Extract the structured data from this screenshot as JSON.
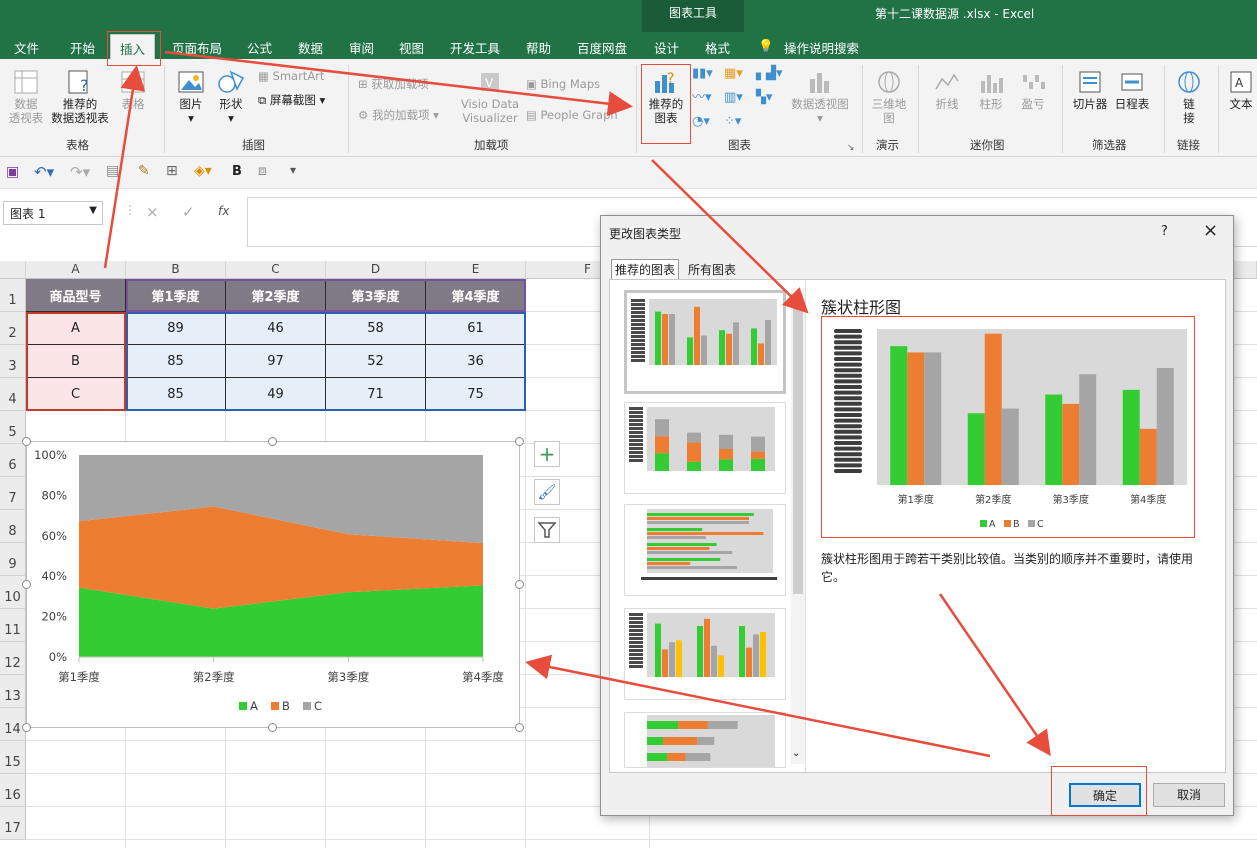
{
  "titlebar": {
    "context_tool": "图表工具",
    "document_title": "第十二课数据源 .xlsx  -  Excel"
  },
  "tabs": [
    "文件",
    "开始",
    "插入",
    "页面布局",
    "公式",
    "数据",
    "审阅",
    "视图",
    "开发工具",
    "帮助",
    "百度网盘",
    "设计",
    "格式"
  ],
  "tellme": "操作说明搜索",
  "ribbon": {
    "pivot_l1": "数据",
    "pivot_l2": "透视表",
    "rec_pivot_l1": "推荐的",
    "rec_pivot_l2": "数据透视表",
    "table": "表格",
    "picture": "图片",
    "shapes": "形状",
    "smartart": "SmartArt",
    "screenshot": "屏幕截图",
    "get_addins": "获取加载项",
    "my_addins": "我的加载项",
    "visio_l1": "Visio Data",
    "visio_l2": "Visualizer",
    "bing_maps": "Bing Maps",
    "people_graph": "People Graph",
    "rec_chart_l1": "推荐的",
    "rec_chart_l2": "图表",
    "pivot_chart": "数据透视图",
    "map3d_l1": "三维地",
    "map3d_l2": "图",
    "line": "折线",
    "column": "柱形",
    "winloss": "盈亏",
    "slicer": "切片器",
    "timeline": "日程表",
    "link_l1": "链",
    "link_l2": "接",
    "textbox": "文本",
    "groups": {
      "tables": "表格",
      "illustrations": "插图",
      "addins": "加载项",
      "charts": "图表",
      "tours": "演示",
      "sparklines": "迷你图",
      "filters": "筛选器",
      "links": "链接"
    }
  },
  "formula_bar": {
    "name_box": "图表 1",
    "fx": "fx",
    "cancel": "×",
    "enter": "✓"
  },
  "columns": [
    "A",
    "B",
    "C",
    "D",
    "E",
    "F"
  ],
  "rows": [
    "1",
    "2",
    "3",
    "4",
    "5",
    "6",
    "7",
    "8",
    "9",
    "10",
    "11",
    "12",
    "13",
    "14",
    "15",
    "16",
    "17"
  ],
  "table": {
    "headers": [
      "商品型号",
      "第1季度",
      "第2季度",
      "第3季度",
      "第4季度"
    ],
    "rows": [
      {
        "label": "A",
        "values": [
          "89",
          "46",
          "58",
          "61"
        ]
      },
      {
        "label": "B",
        "values": [
          "85",
          "97",
          "52",
          "36"
        ]
      },
      {
        "label": "C",
        "values": [
          "85",
          "49",
          "71",
          "75"
        ]
      }
    ]
  },
  "chart_data": {
    "type": "area",
    "stacked": "percent",
    "categories": [
      "第1季度",
      "第2季度",
      "第3季度",
      "第4季度"
    ],
    "series": [
      {
        "name": "A",
        "values": [
          89,
          46,
          58,
          61
        ],
        "color": "#33cc33"
      },
      {
        "name": "B",
        "values": [
          85,
          97,
          52,
          36
        ],
        "color": "#ed7d31"
      },
      {
        "name": "C",
        "values": [
          85,
          49,
          71,
          75
        ],
        "color": "#a5a5a5"
      }
    ],
    "yticks": [
      "0%",
      "20%",
      "40%",
      "60%",
      "80%",
      "100%"
    ],
    "ylim": [
      0,
      100
    ],
    "legend": "bottom"
  },
  "dialog": {
    "title": "更改图表类型",
    "help": "?",
    "close": "×",
    "tab_recommended": "推荐的图表",
    "tab_all": "所有图表",
    "preview_title": "簇状柱形图",
    "description": "簇状柱形图用于跨若干类别比较值。当类别的顺序并不重要时，请使用它。",
    "ok": "确定",
    "cancel": "取消",
    "preview_chart": {
      "type": "bar",
      "categories": [
        "第1季度",
        "第2季度",
        "第3季度",
        "第4季度"
      ],
      "series": [
        {
          "name": "A",
          "values": [
            89,
            46,
            58,
            61
          ],
          "color": "#33cc33"
        },
        {
          "name": "B",
          "values": [
            85,
            97,
            52,
            36
          ],
          "color": "#ed7d31"
        },
        {
          "name": "C",
          "values": [
            85,
            49,
            71,
            75
          ],
          "color": "#a5a5a5"
        }
      ],
      "ylim": [
        0,
        100
      ]
    }
  }
}
